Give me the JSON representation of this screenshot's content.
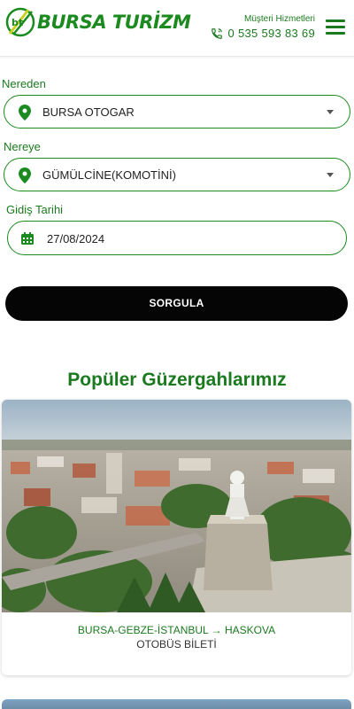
{
  "header": {
    "brand": "BURSA TURİZM",
    "customer_service_label": "Müşteri Hizmetleri",
    "phone": "0 535 593 83 69"
  },
  "form": {
    "from_label": "Nereden",
    "from_value": "BURSA OTOGAR",
    "to_label": "Nereye",
    "to_value": "GÜMÜLCİNE(KOMOTİNİ)",
    "date_label": "Gidiş Tarihi",
    "date_value": "27/08/2024",
    "search_button": "SORGULA"
  },
  "popular": {
    "title": "Popüler Güzergahlarımız",
    "routes": [
      {
        "route": "BURSA-GEBZE-İSTANBUL → HASKOVA",
        "type": "OTOBÜS BİLETİ"
      }
    ]
  },
  "colors": {
    "brand_green": "#1b7a1f",
    "button_black": "#050505"
  },
  "icons": [
    "menu-icon",
    "phone-icon",
    "location-pin-icon",
    "caret-down-icon",
    "calendar-icon"
  ]
}
